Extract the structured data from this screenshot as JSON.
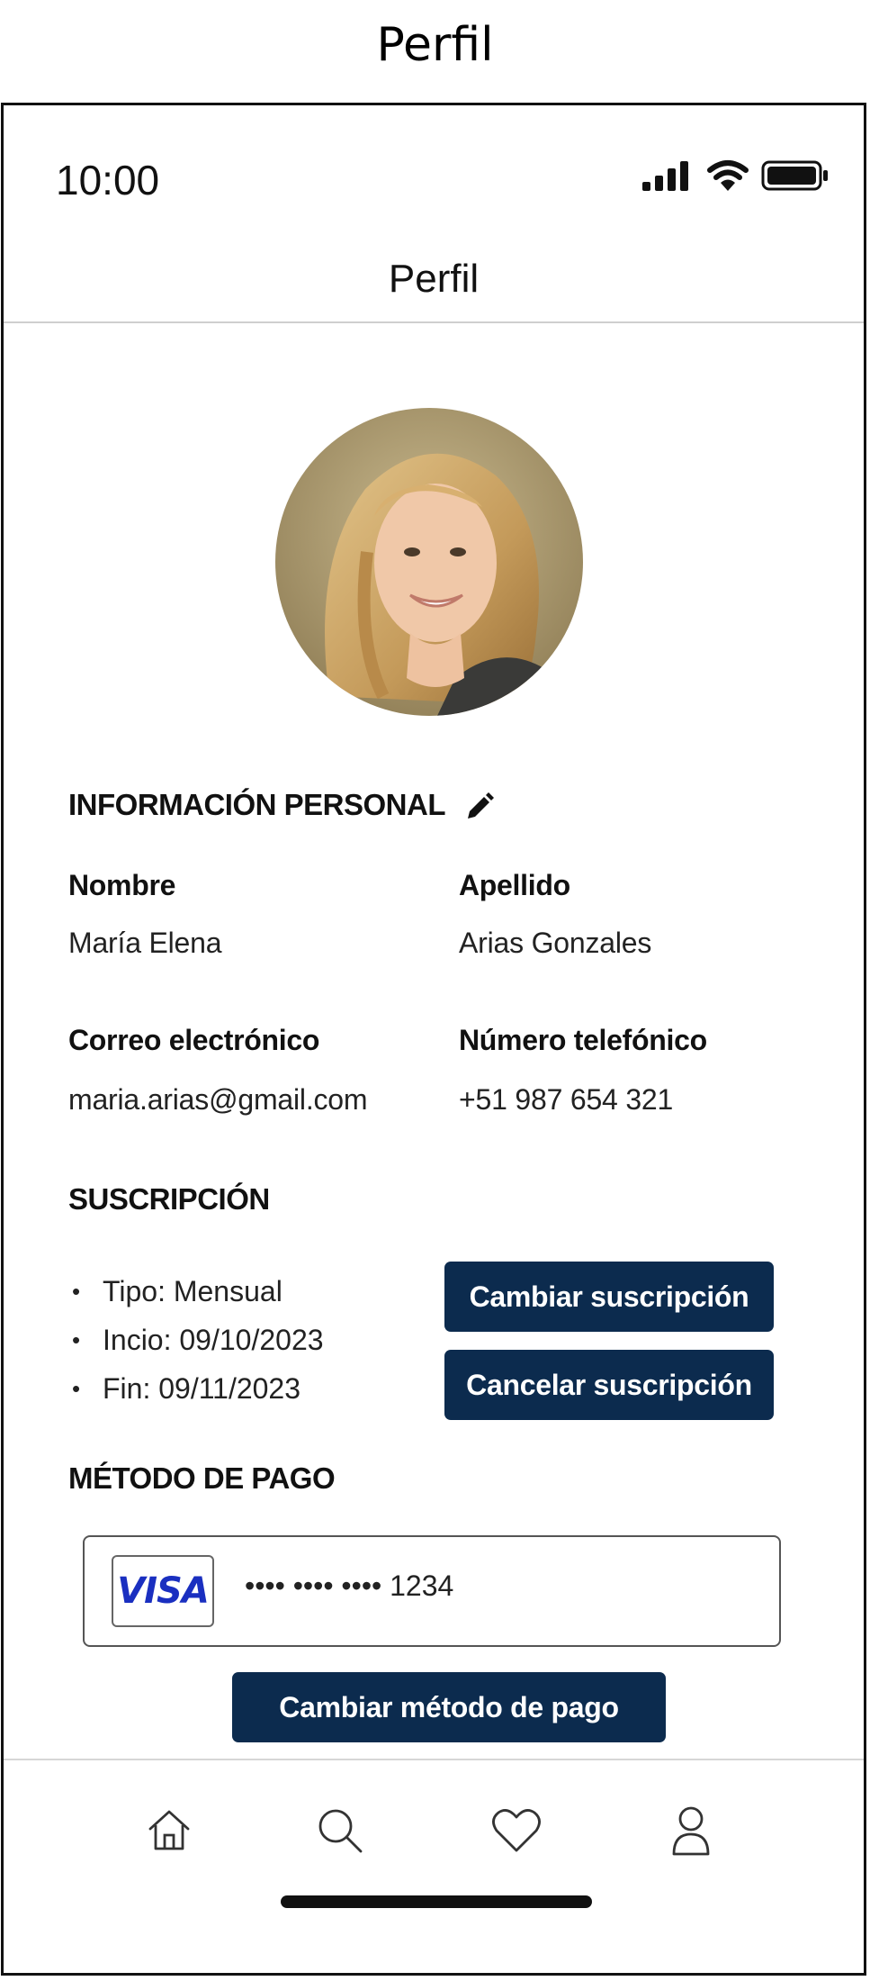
{
  "caption": "Perfil",
  "status_bar": {
    "time": "10:00",
    "icons": [
      "signal-icon",
      "wifi-icon",
      "battery-icon"
    ]
  },
  "header": {
    "title": "Perfil"
  },
  "personal_info": {
    "section_title": "INFORMACIÓN PERSONAL",
    "edit_icon": "pencil-icon",
    "first_name_label": "Nombre",
    "first_name_value": "María Elena",
    "last_name_label": "Apellido",
    "last_name_value": "Arias Gonzales",
    "email_label": "Correo electrónico",
    "email_value": "maria.arias@gmail.com",
    "phone_label": "Número telefónico",
    "phone_value": "+51 987 654 321"
  },
  "subscription": {
    "section_title": "SUSCRIPCIÓN",
    "details": [
      "Tipo: Mensual",
      "Incio: 09/10/2023",
      "Fin: 09/11/2023"
    ],
    "change_button": "Cambiar suscripción",
    "cancel_button": "Cancelar suscripción"
  },
  "payment": {
    "section_title": "MÉTODO DE PAGO",
    "card_brand": "VISA",
    "card_number": "•••• •••• •••• 1234",
    "change_button": "Cambiar método de pago"
  },
  "bottom_nav": {
    "items": [
      "home-icon",
      "search-icon",
      "heart-icon",
      "user-icon"
    ]
  },
  "colors": {
    "button_bg": "#0c2b4e",
    "visa_blue": "#1a2fc0"
  }
}
